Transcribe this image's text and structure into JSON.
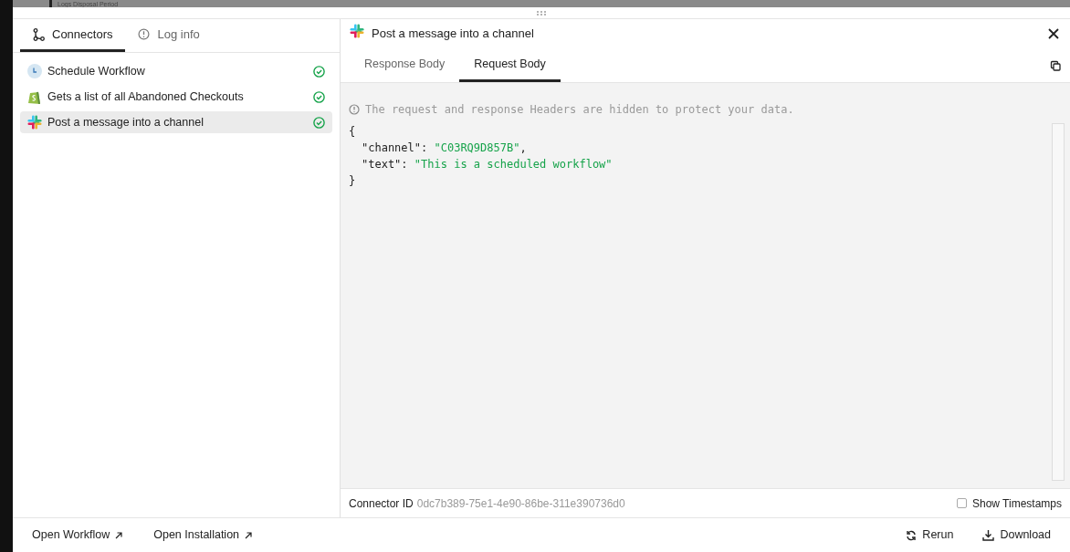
{
  "background": {
    "label": "Logs Disposal Period"
  },
  "left_tabs": [
    {
      "label": "Connectors",
      "selected": true
    },
    {
      "label": "Log info",
      "selected": false
    }
  ],
  "connectors": [
    {
      "label": "Schedule Workflow",
      "selected": false,
      "done": true
    },
    {
      "label": "Gets a list of all Abandoned Checkouts",
      "selected": false,
      "done": true
    },
    {
      "label": "Post a message into a channel",
      "selected": true,
      "done": true
    }
  ],
  "detail": {
    "title": "Post a message into a channel",
    "tabs": [
      {
        "label": "Response Body",
        "selected": false
      },
      {
        "label": "Request Body",
        "selected": true
      }
    ],
    "notice": "The request and response Headers are hidden to protect your data.",
    "code_lines": [
      {
        "indented": false,
        "parts": [
          {
            "kind": "punct",
            "text": "{"
          }
        ]
      },
      {
        "indented": true,
        "parts": [
          {
            "kind": "key",
            "text": "\"channel\""
          },
          {
            "kind": "punct",
            "text": ": "
          },
          {
            "kind": "string",
            "text": "\"C03RQ9D857B\""
          },
          {
            "kind": "punct",
            "text": ","
          }
        ]
      },
      {
        "indented": true,
        "parts": [
          {
            "kind": "key",
            "text": "\"text\""
          },
          {
            "kind": "punct",
            "text": ": "
          },
          {
            "kind": "string",
            "text": "\"This is a scheduled workflow\""
          }
        ]
      },
      {
        "indented": false,
        "parts": [
          {
            "kind": "punct",
            "text": "}"
          }
        ]
      }
    ],
    "connector_id_label": "Connector ID",
    "connector_id": "0dc7b389-75e1-4e90-86be-311e390736d0",
    "show_timestamps": {
      "label": "Show Timestamps",
      "checked": false
    }
  },
  "footer_links": [
    {
      "label": "Open Workflow"
    },
    {
      "label": "Open Installation"
    }
  ],
  "footer_actions": [
    {
      "label": "Rerun"
    },
    {
      "label": "Download"
    }
  ]
}
